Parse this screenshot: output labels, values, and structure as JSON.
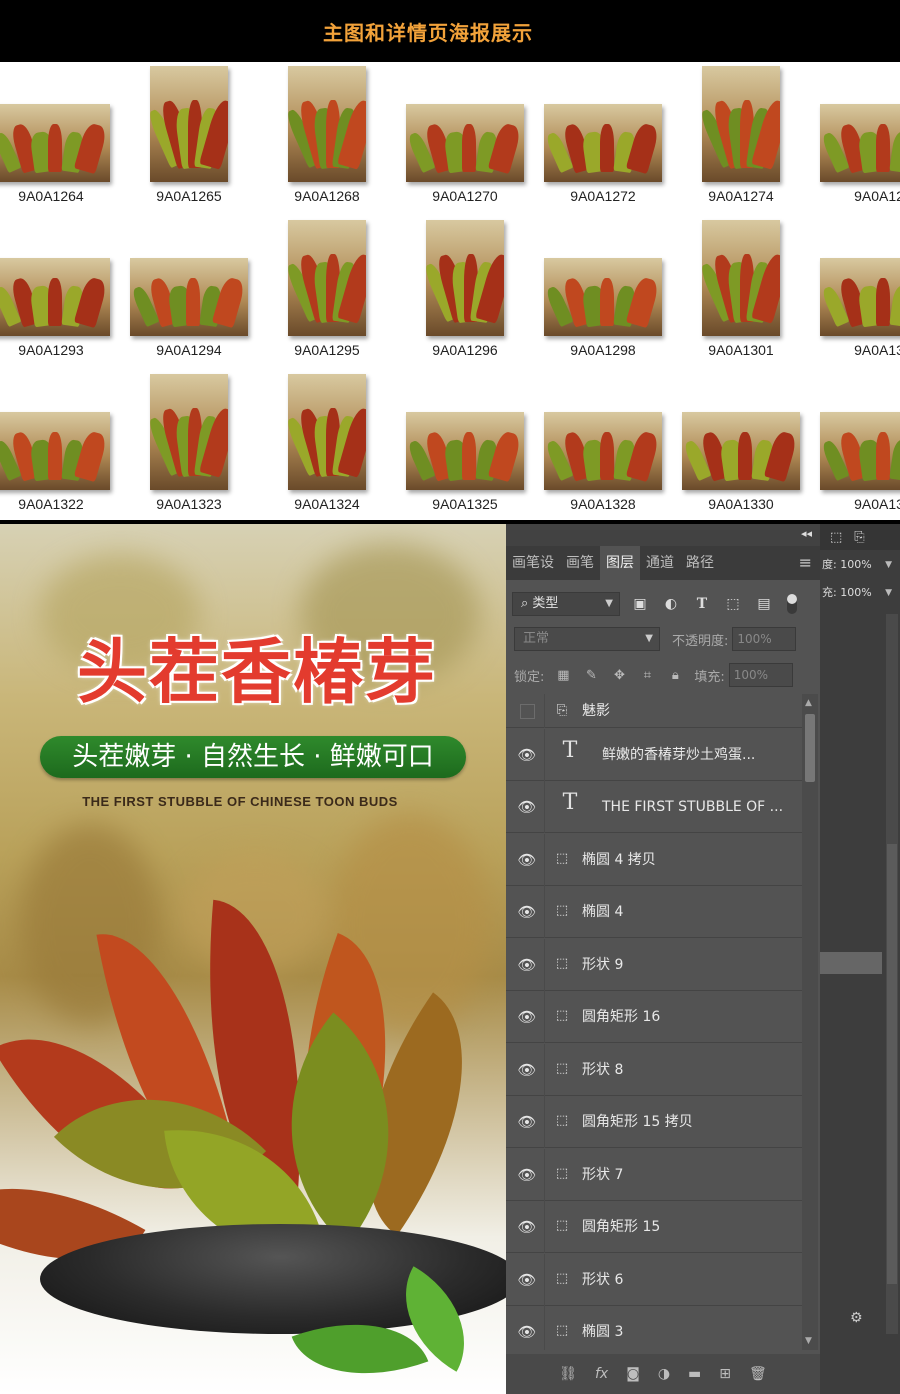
{
  "header": {
    "title": "主图和详情页海报展示"
  },
  "grid": {
    "rows": [
      [
        {
          "name": "9A0A1264",
          "shape": "land"
        },
        {
          "name": "9A0A1265",
          "shape": "port"
        },
        {
          "name": "9A0A1268",
          "shape": "port"
        },
        {
          "name": "9A0A1270",
          "shape": "land"
        },
        {
          "name": "9A0A1272",
          "shape": "land"
        },
        {
          "name": "9A0A1274",
          "shape": "port"
        },
        {
          "name": "9A0A12",
          "shape": "land"
        }
      ],
      [
        {
          "name": "9A0A1293",
          "shape": "land"
        },
        {
          "name": "9A0A1294",
          "shape": "land"
        },
        {
          "name": "9A0A1295",
          "shape": "port"
        },
        {
          "name": "9A0A1296",
          "shape": "port"
        },
        {
          "name": "9A0A1298",
          "shape": "land"
        },
        {
          "name": "9A0A1301",
          "shape": "port"
        },
        {
          "name": "9A0A13",
          "shape": "land"
        }
      ],
      [
        {
          "name": "9A0A1322",
          "shape": "land"
        },
        {
          "name": "9A0A1323",
          "shape": "port"
        },
        {
          "name": "9A0A1324",
          "shape": "port"
        },
        {
          "name": "9A0A1325",
          "shape": "land"
        },
        {
          "name": "9A0A1328",
          "shape": "land"
        },
        {
          "name": "9A0A1330",
          "shape": "land"
        },
        {
          "name": "9A0A13",
          "shape": "land"
        }
      ]
    ]
  },
  "poster": {
    "title": "头茬香椿芽",
    "banner": "头茬嫩芽 · 自然生长 · 鲜嫩可口",
    "subtitle": "THE FIRST STUBBLE OF CHINESE TOON BUDS"
  },
  "ps": {
    "tabs": [
      "画笔设",
      "画笔",
      "图层",
      "通道",
      "路径"
    ],
    "active_tab": "图层",
    "filter_kind": "类型",
    "blend_mode": "正常",
    "opacity_label": "不透明度:",
    "opacity_value": "100%",
    "lock_label": "锁定:",
    "fill_label": "填充:",
    "fill_value": "100%",
    "layers": [
      {
        "name": "魅影",
        "type": "group",
        "visible": false
      },
      {
        "name": "鲜嫩的香椿芽炒土鸡蛋...",
        "type": "text",
        "visible": true
      },
      {
        "name": "THE FIRST STUBBLE OF ...",
        "type": "text",
        "visible": true
      },
      {
        "name": "椭圆 4 拷贝",
        "type": "shape",
        "visible": true
      },
      {
        "name": "椭圆 4",
        "type": "shape",
        "visible": true
      },
      {
        "name": "形状 9",
        "type": "shape",
        "visible": true
      },
      {
        "name": "圆角矩形 16",
        "type": "shape",
        "visible": true
      },
      {
        "name": "形状 8",
        "type": "shape",
        "visible": true
      },
      {
        "name": "圆角矩形 15 拷贝",
        "type": "shape",
        "visible": true
      },
      {
        "name": "形状 7",
        "type": "shape",
        "visible": true
      },
      {
        "name": "圆角矩形 15",
        "type": "shape",
        "visible": true
      },
      {
        "name": "形状 6",
        "type": "shape",
        "visible": true
      },
      {
        "name": "椭圆 3",
        "type": "shape",
        "visible": true
      }
    ],
    "side_props": [
      {
        "label": "度:",
        "value": "100%"
      },
      {
        "label": "充:",
        "value": "100%"
      }
    ]
  }
}
